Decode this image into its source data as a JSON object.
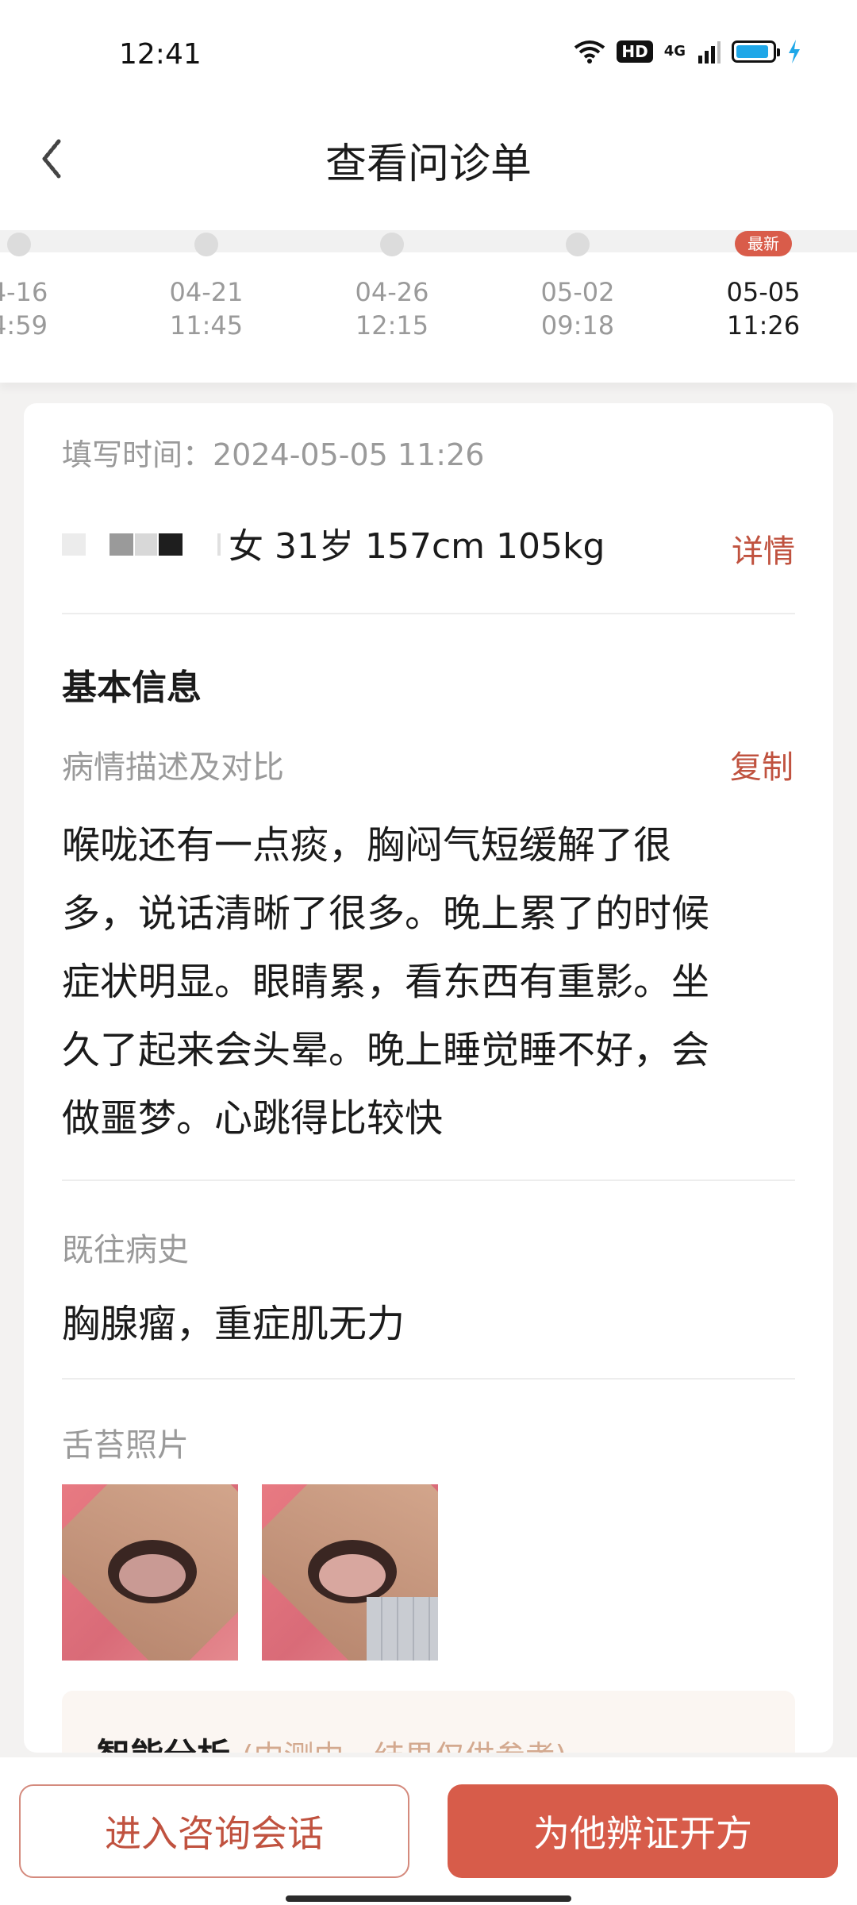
{
  "status_bar": {
    "time": "12:41",
    "hd_badge": "HD",
    "network": "4G",
    "battery_level_percent": 90,
    "accent": "#1fa7e8"
  },
  "header": {
    "title": "查看问诊单",
    "back_icon": "back-arrow-icon"
  },
  "timeline": {
    "latest_badge": "最新",
    "entries": [
      {
        "date": "4-16",
        "time": "4:59"
      },
      {
        "date": "04-21",
        "time": "11:45"
      },
      {
        "date": "04-26",
        "time": "12:15"
      },
      {
        "date": "05-02",
        "time": "09:18"
      },
      {
        "date": "05-05",
        "time": "11:26"
      }
    ]
  },
  "card": {
    "fill_time": "填写时间：2024-05-05 11:26",
    "patient_info": "女 31岁 157cm 105kg",
    "detail_link": "详情",
    "basic_info_title": "基本信息",
    "description_label": "病情描述及对比",
    "copy_link": "复制",
    "description_lines": [
      "喉咙还有一点痰，胸闷气短缓解了很",
      "多，说话清晰了很多。晚上累了的时候",
      "症状明显。眼睛累，看东西有重影。坐",
      "久了起来会头晕。晚上睡觉睡不好，会",
      "做噩梦。心跳得比较快"
    ],
    "history_label": "既往病史",
    "history_text": "胸腺瘤，重症肌无力",
    "tongue_label": "舌苔照片",
    "ai_title": "智能分析",
    "ai_note": "(内测中，结果仅供参考)"
  },
  "bottom_bar": {
    "consult_button": "进入咨询会话",
    "prescribe_button": "为他辨证开方"
  },
  "colors": {
    "brand": "#d75c4a",
    "link": "#c0523f",
    "muted": "#9a9a9a",
    "background": "#f3f2f1"
  }
}
